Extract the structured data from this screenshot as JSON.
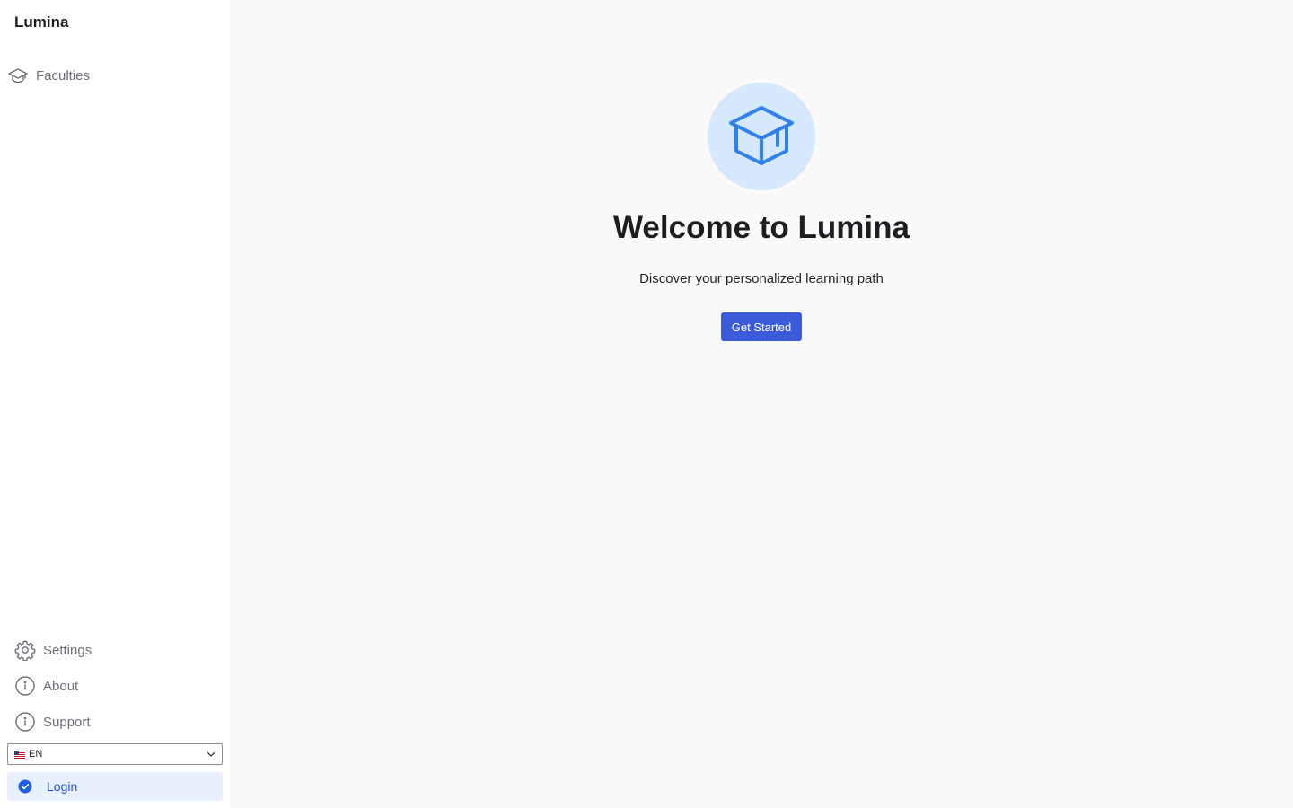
{
  "app": {
    "name": "Lumina"
  },
  "sidebar": {
    "top_items": [
      {
        "label": "Faculties",
        "icon": "graduation-cap-icon"
      }
    ],
    "bottom_items": [
      {
        "label": "Settings",
        "icon": "gear-icon"
      },
      {
        "label": "About",
        "icon": "info-icon"
      },
      {
        "label": "Support",
        "icon": "info-icon"
      }
    ],
    "language": {
      "selected": "EN",
      "flag": "us-flag-icon"
    },
    "login": {
      "label": "Login",
      "icon": "check-circle-icon"
    }
  },
  "main": {
    "hero_icon": "graduation-cap-icon",
    "title": "Welcome to Lumina",
    "subtitle": "Discover your personalized learning path",
    "cta_label": "Get Started"
  },
  "colors": {
    "accent": "#3b5bdb",
    "hero_circle": "#d6e8fd",
    "hero_icon": "#2f80ed",
    "login_bg": "#e8f0fe"
  }
}
